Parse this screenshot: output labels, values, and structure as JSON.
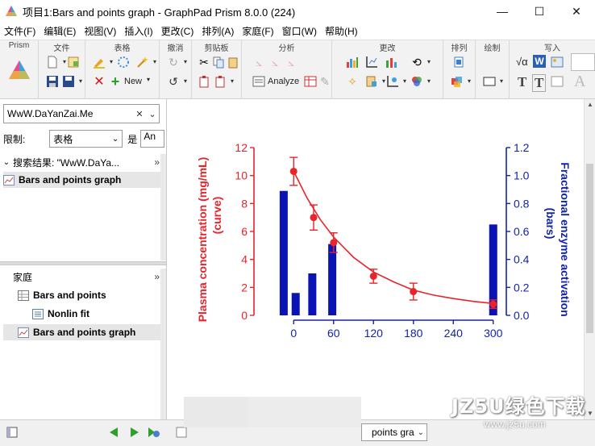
{
  "window": {
    "title": "项目1:Bars and points graph - GraphPad Prism 8.0.0 (224)",
    "minimize": "—",
    "maximize": "☐",
    "close": "✕"
  },
  "menu": [
    "文件(F)",
    "编辑(E)",
    "视图(V)",
    "插入(I)",
    "更改(C)",
    "排列(A)",
    "家庭(F)",
    "窗口(W)",
    "帮助(H)"
  ],
  "ribbon": {
    "groups": [
      "Prism",
      "文件",
      "表格",
      "撤消",
      "剪贴板",
      "分析",
      "更改",
      "排列",
      "绘制",
      "写入"
    ],
    "new_label": "New",
    "analyze_label": "Analyze",
    "sqrt_label": "√α",
    "w_label": "W",
    "t_label": "T",
    "t2_label": "T",
    "a_label": "A"
  },
  "navigator": {
    "search_value": "WwW.DaYanZai.Me",
    "filter_label": "限制:",
    "filter_value": "表格",
    "filter_is": "是",
    "filter_value2": "An",
    "results_header": "搜索结果: \"WwW.DaYa...",
    "results_item": "Bars and points graph",
    "family_header": "家庭",
    "family_items": [
      "Bars and points",
      "Nonlin fit",
      "Bars and points graph"
    ]
  },
  "chart_data": {
    "type": "bar",
    "x_ticks": [
      "0",
      "60",
      "120",
      "180",
      "240",
      "300"
    ],
    "xlim": [
      -50,
      310
    ],
    "left_axis": {
      "label": "Plasma concentration (mg/mL)",
      "label2": "(curve)",
      "ylim": [
        0,
        12
      ],
      "ticks": [
        "0",
        "2",
        "4",
        "6",
        "8",
        "10",
        "12"
      ],
      "color": "#e8232a"
    },
    "right_axis": {
      "label": "Fractional enzyme activation",
      "label2": "(bars)",
      "ylim": [
        0,
        1.2
      ],
      "ticks": [
        "0.0",
        "0.2",
        "0.4",
        "0.6",
        "0.8",
        "1.0",
        "1.2"
      ],
      "color": "#1424a8"
    },
    "bars": {
      "x": [
        -15,
        3,
        28,
        58,
        125,
        242,
        300
      ],
      "values": [
        0.89,
        0.16,
        0.3,
        0.51,
        0.0,
        0.0,
        0.65
      ],
      "color": "#0a14b4"
    },
    "points": {
      "x": [
        0,
        15,
        30,
        60,
        120,
        180,
        300
      ],
      "y": [
        10.3,
        0,
        7.0,
        5.2,
        2.8,
        1.7,
        0.8
      ],
      "err": [
        1.0,
        0,
        0.9,
        0.7,
        0.5,
        0.6,
        0.3
      ],
      "color": "#e8232a"
    },
    "curve": {
      "x": [
        0,
        20,
        40,
        60,
        90,
        120,
        150,
        180,
        210,
        240,
        270,
        300
      ],
      "y": [
        10.3,
        8.4,
        6.85,
        5.6,
        4.15,
        3.1,
        2.4,
        1.8,
        1.45,
        1.2,
        1.0,
        0.85
      ],
      "color": "#e8232a"
    }
  },
  "bottom": {
    "sheet_select": "points gra"
  },
  "watermark": {
    "main": "JZ5U绿色下载",
    "sub": "www.jz5u.com"
  }
}
